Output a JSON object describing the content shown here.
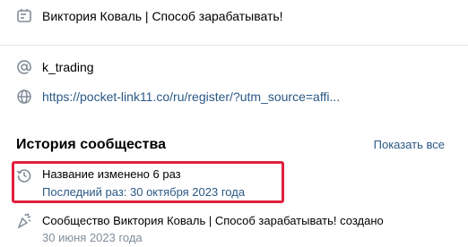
{
  "info": {
    "description": "Виктория Коваль | Способ зарабатывать!",
    "username": "k_trading",
    "link": "https://pocket-link11.co/ru/register/?utm_source=affi..."
  },
  "history": {
    "title": "История сообщества",
    "show_all": "Показать все",
    "items": [
      {
        "icon": "history-icon",
        "text": "Название изменено 6 раз",
        "sub": "Последний раз: 30 октября 2023 года"
      },
      {
        "icon": "party-popper-icon",
        "text": "Сообщество Виктория Коваль | Способ зарабатывать! создано",
        "sub": "30 июня 2023 года"
      }
    ]
  },
  "colors": {
    "link": "#2a5885",
    "icon": "#818c99",
    "highlight": "#e0203f",
    "divider": "#e7e8ec"
  }
}
